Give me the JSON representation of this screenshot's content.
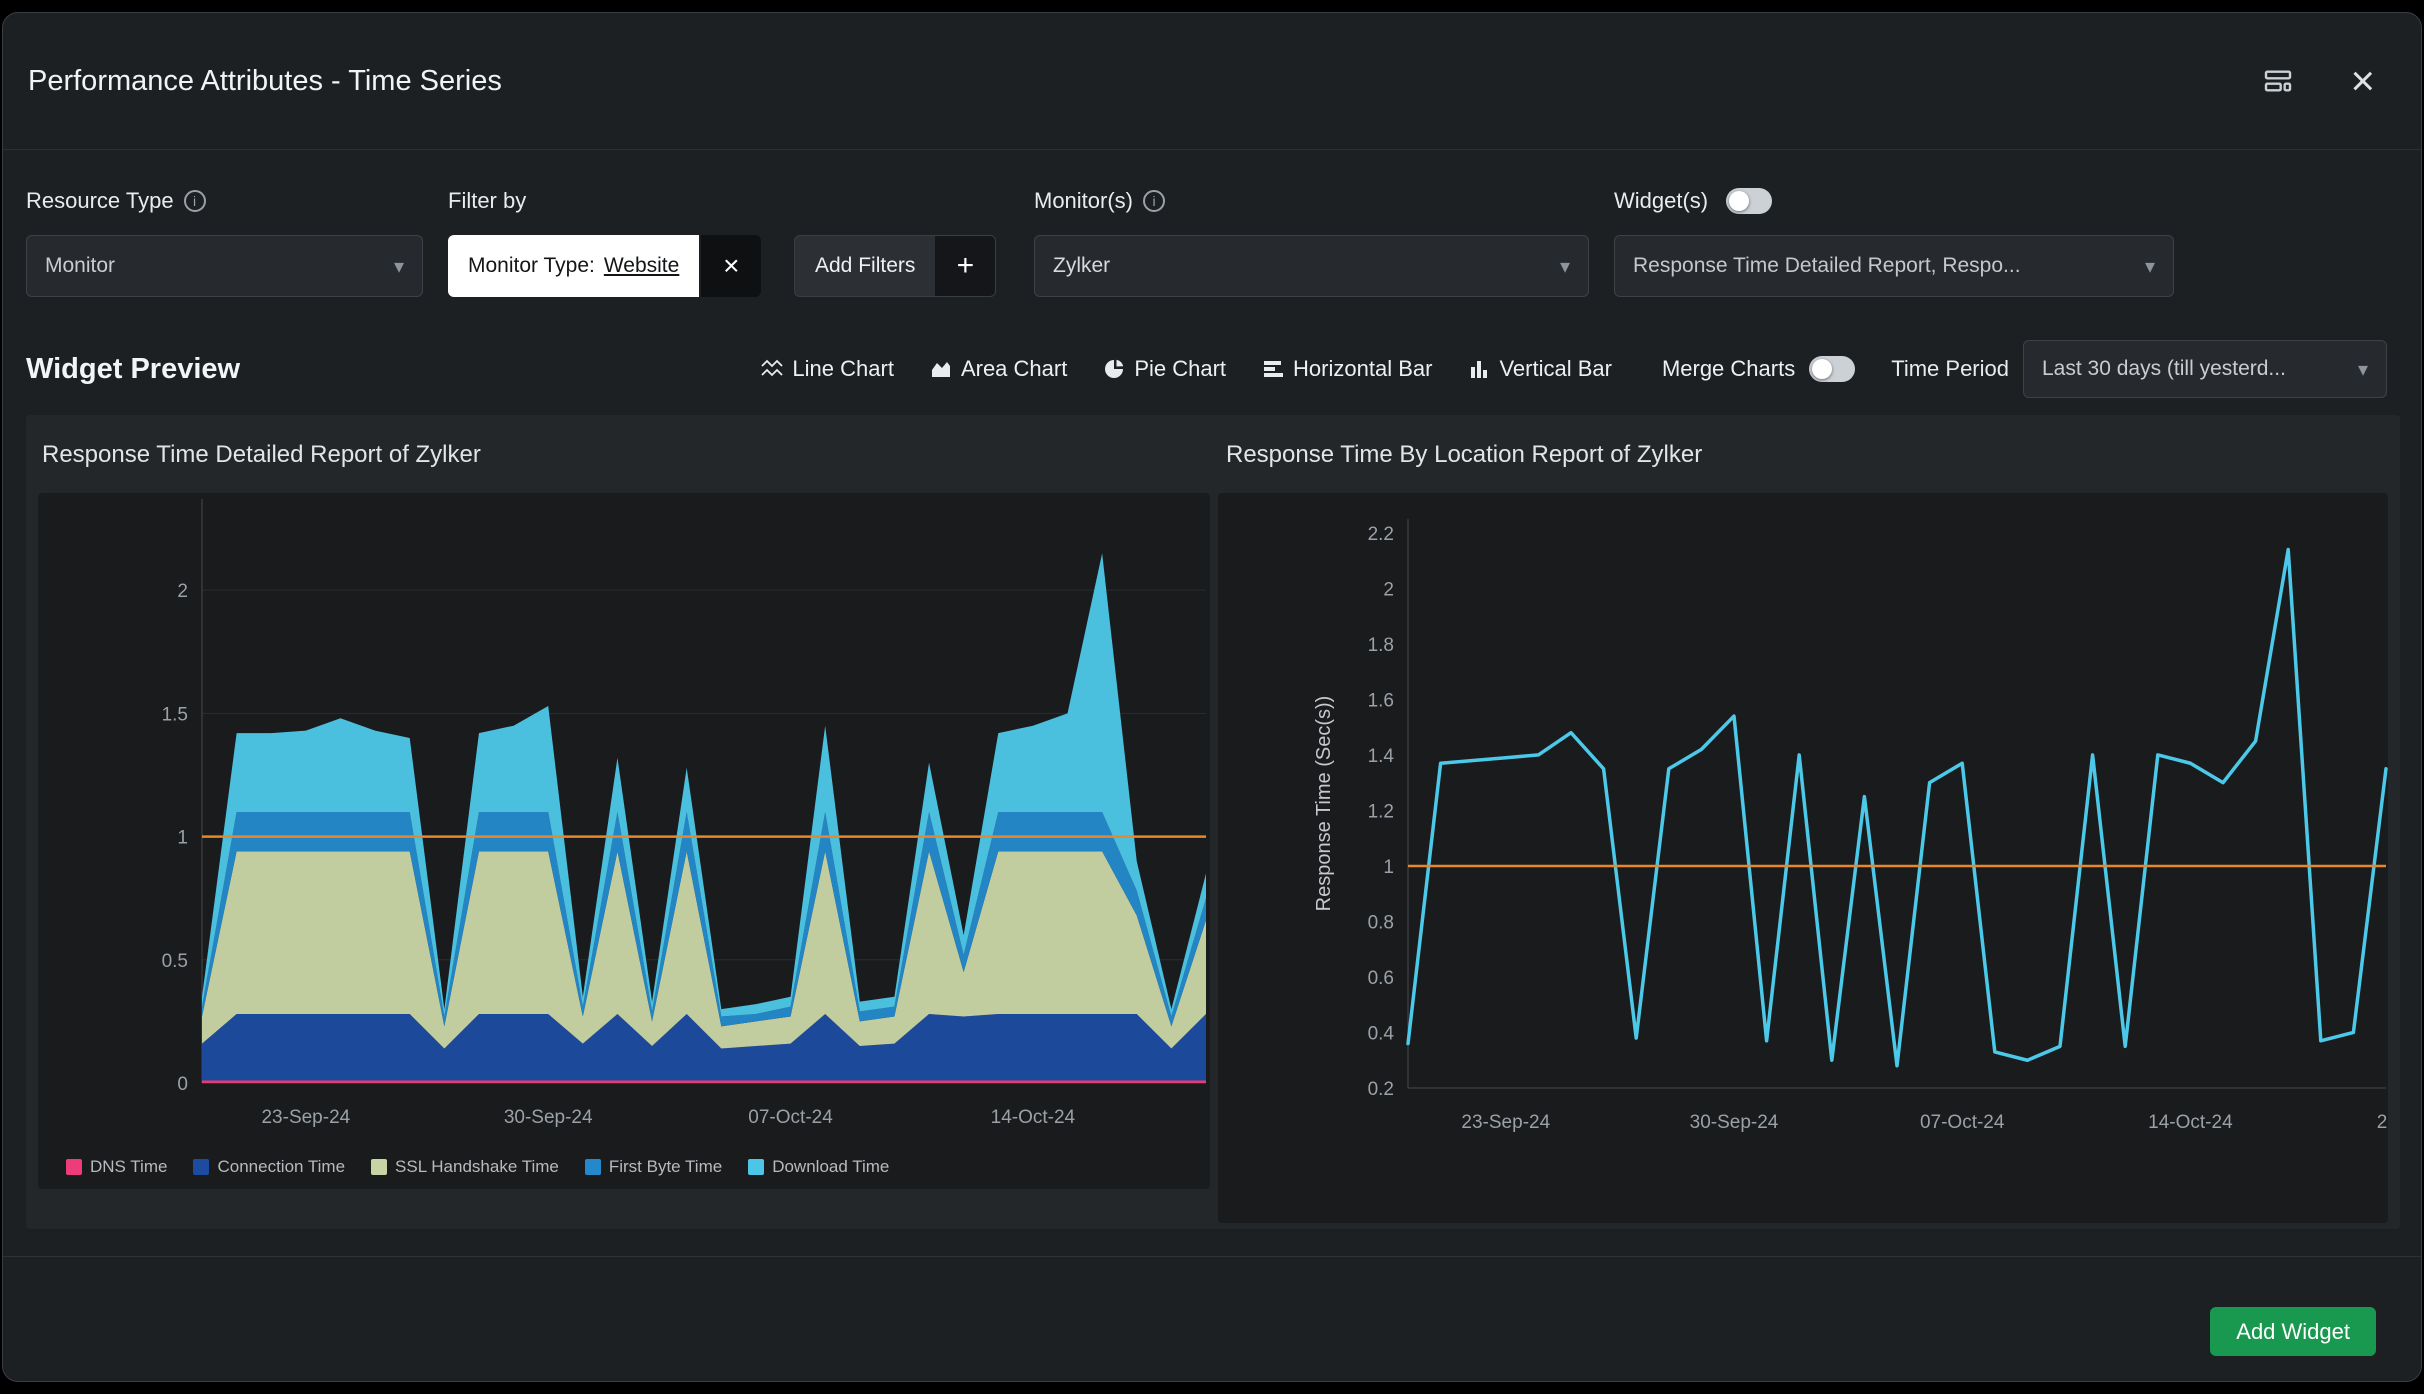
{
  "icons": {
    "close": "×",
    "plus": "+",
    "chevron": "▾",
    "info": "i"
  },
  "modal": {
    "title": "Performance Attributes - Time Series"
  },
  "filters": {
    "resource_type": {
      "label": "Resource Type",
      "value": "Monitor"
    },
    "filter_by": {
      "label": "Filter by",
      "chip_label": "Monitor Type:",
      "chip_value": "Website",
      "add_filters": "Add Filters"
    },
    "monitors": {
      "label": "Monitor(s)",
      "value": "Zylker"
    },
    "widgets": {
      "label": "Widget(s)",
      "value": "Response Time Detailed Report, Respo..."
    }
  },
  "preview": {
    "heading": "Widget Preview",
    "chart_types": [
      {
        "label": "Line Chart"
      },
      {
        "label": "Area Chart"
      },
      {
        "label": "Pie Chart"
      },
      {
        "label": "Horizontal Bar"
      },
      {
        "label": "Vertical Bar"
      }
    ],
    "merge_charts": "Merge Charts",
    "time_period_label": "Time Period",
    "time_period_value": "Last 30 days (till yesterd..."
  },
  "footer": {
    "add_widget": "Add Widget"
  },
  "colors": {
    "accent_green": "#18994f",
    "threshold_orange": "#e8872d",
    "line_cyan": "#4cc8e8"
  },
  "chart_data": [
    {
      "type": "area",
      "stacked": true,
      "title": "Response Time Detailed Report of Zylker",
      "points": 30,
      "x_tick_positions": [
        3,
        10,
        17,
        24
      ],
      "x_tick_labels": [
        "23-Sep-24",
        "30-Sep-24",
        "07-Oct-24",
        "14-Oct-24"
      ],
      "y_ticks": [
        0,
        0.5,
        1,
        1.5,
        2
      ],
      "y_tick_labels": [
        "0",
        "0.5",
        "1",
        "1.5",
        "2"
      ],
      "ylim": [
        0,
        2.37
      ],
      "threshold": 1,
      "grid": true,
      "grid_color": "#2a2d30",
      "axis_color": "#45494e",
      "tick_color": "#9aa1a8",
      "threshold_color": "#e8872d",
      "series": [
        {
          "name": "DNS Time",
          "color": "#ee3c78",
          "values": [
            0.01,
            0.01,
            0.01,
            0.01,
            0.01,
            0.01,
            0.01,
            0.01,
            0.01,
            0.01,
            0.01,
            0.01,
            0.01,
            0.01,
            0.01,
            0.01,
            0.01,
            0.01,
            0.01,
            0.01,
            0.01,
            0.01,
            0.01,
            0.01,
            0.01,
            0.01,
            0.01,
            0.01,
            0.01,
            0.01
          ]
        },
        {
          "name": "Connection Time",
          "color": "#1d4ba0",
          "values": [
            0.15,
            0.27,
            0.27,
            0.27,
            0.27,
            0.27,
            0.27,
            0.13,
            0.27,
            0.27,
            0.27,
            0.15,
            0.27,
            0.14,
            0.27,
            0.13,
            0.14,
            0.15,
            0.27,
            0.14,
            0.15,
            0.27,
            0.26,
            0.27,
            0.27,
            0.27,
            0.27,
            0.27,
            0.13,
            0.27
          ]
        },
        {
          "name": "SSL Handshake Time",
          "color": "#c9d4a4",
          "values": [
            0.11,
            0.66,
            0.66,
            0.66,
            0.66,
            0.66,
            0.66,
            0.09,
            0.66,
            0.66,
            0.66,
            0.11,
            0.66,
            0.1,
            0.66,
            0.09,
            0.1,
            0.11,
            0.66,
            0.1,
            0.11,
            0.66,
            0.18,
            0.66,
            0.66,
            0.66,
            0.66,
            0.4,
            0.09,
            0.38
          ]
        },
        {
          "name": "First Byte Time",
          "color": "#2489cc",
          "values": [
            0.04,
            0.16,
            0.16,
            0.16,
            0.16,
            0.16,
            0.16,
            0.04,
            0.16,
            0.16,
            0.16,
            0.04,
            0.16,
            0.04,
            0.16,
            0.04,
            0.03,
            0.04,
            0.16,
            0.04,
            0.04,
            0.16,
            0.07,
            0.16,
            0.16,
            0.16,
            0.16,
            0.1,
            0.04,
            0.09
          ]
        },
        {
          "name": "Download Time",
          "color": "#4cc6e6",
          "values": [
            0.04,
            0.32,
            0.32,
            0.33,
            0.38,
            0.33,
            0.3,
            0.03,
            0.32,
            0.35,
            0.43,
            0.04,
            0.22,
            0.04,
            0.18,
            0.03,
            0.04,
            0.04,
            0.35,
            0.04,
            0.04,
            0.2,
            0.08,
            0.32,
            0.35,
            0.4,
            1.05,
            0.12,
            0.03,
            0.1
          ]
        }
      ]
    },
    {
      "type": "line",
      "title": "Response Time By Location Report of Zylker",
      "ylabel": "Response Time (Sec(s))",
      "color": "#4cc8e8",
      "points": 31,
      "x_tick_positions": [
        3,
        10,
        17,
        24,
        30
      ],
      "x_tick_labels": [
        "23-Sep-24",
        "30-Sep-24",
        "07-Oct-24",
        "14-Oct-24",
        "2"
      ],
      "y_ticks": [
        0.2,
        0.4,
        0.6,
        0.8,
        1,
        1.2,
        1.4,
        1.6,
        1.8,
        2,
        2.2
      ],
      "y_tick_labels": [
        "0.2",
        "0.4",
        "0.6",
        "0.8",
        "1",
        "1.2",
        "1.4",
        "1.6",
        "1.8",
        "2",
        "2.2"
      ],
      "ylim": [
        0.2,
        2.25
      ],
      "threshold": 1,
      "grid": false,
      "axis_color": "#45494e",
      "tick_color": "#9aa1a8",
      "threshold_color": "#e8872d",
      "values": [
        0.36,
        1.37,
        1.38,
        1.39,
        1.4,
        1.48,
        1.35,
        0.38,
        1.35,
        1.42,
        1.54,
        0.37,
        1.4,
        0.3,
        1.25,
        0.28,
        1.3,
        1.37,
        0.33,
        0.3,
        0.35,
        1.4,
        0.35,
        1.4,
        1.37,
        1.3,
        1.45,
        2.14,
        0.37,
        0.4,
        1.35
      ]
    }
  ]
}
